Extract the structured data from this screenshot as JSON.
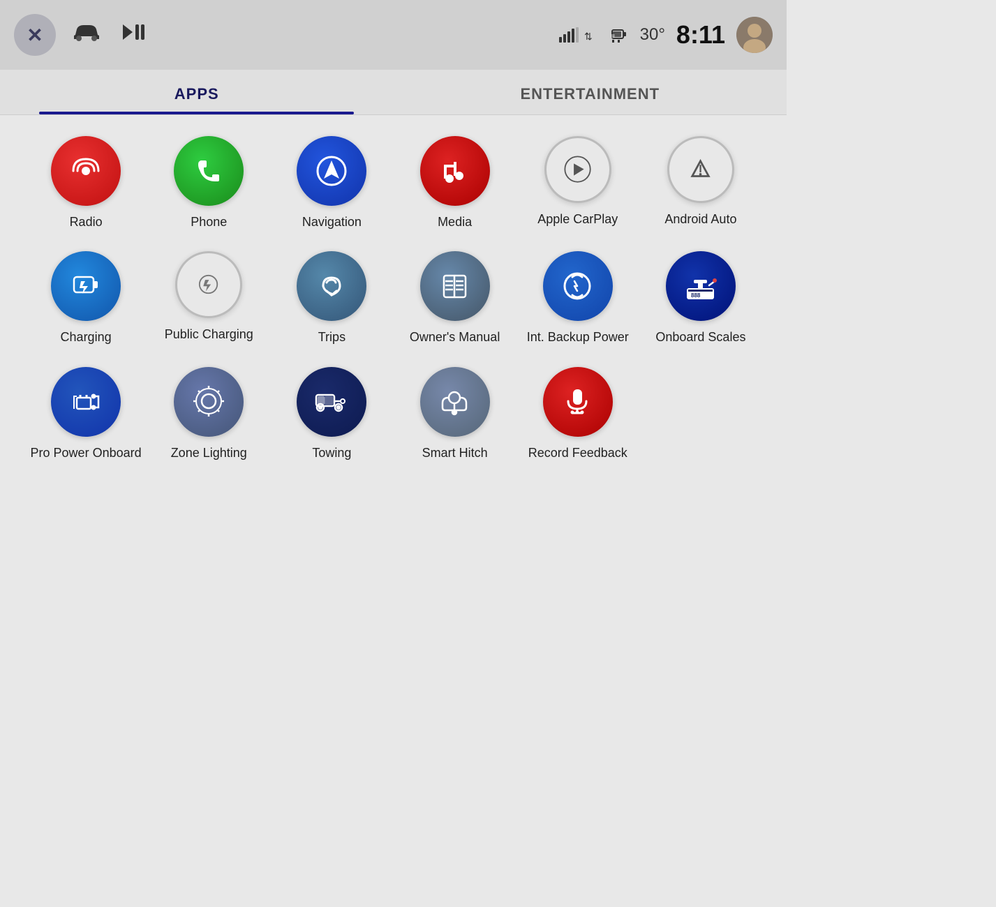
{
  "statusBar": {
    "temperature": "30°",
    "time": "8:11"
  },
  "tabs": [
    {
      "id": "apps",
      "label": "APPS",
      "active": true
    },
    {
      "id": "entertainment",
      "label": "ENTERTAINMENT",
      "active": false
    }
  ],
  "apps": [
    {
      "id": "radio",
      "label": "Radio",
      "iconType": "red",
      "row": 1
    },
    {
      "id": "phone",
      "label": "Phone",
      "iconType": "green",
      "row": 1
    },
    {
      "id": "navigation",
      "label": "Navigation",
      "iconType": "blue-nav",
      "row": 1
    },
    {
      "id": "media",
      "label": "Media",
      "iconType": "red-music",
      "row": 1
    },
    {
      "id": "apple-carplay",
      "label": "Apple CarPlay",
      "iconType": "light-gray",
      "row": 1
    },
    {
      "id": "android-auto",
      "label": "Android Auto",
      "iconType": "gray-auto",
      "row": 1
    },
    {
      "id": "charging",
      "label": "Charging",
      "iconType": "blue-charge",
      "row": 2
    },
    {
      "id": "public-charging",
      "label": "Public Charging",
      "iconType": "light-round",
      "row": 2
    },
    {
      "id": "trips",
      "label": "Trips",
      "iconType": "teal",
      "row": 2
    },
    {
      "id": "owners-manual",
      "label": "Owner's Manual",
      "iconType": "teal-book",
      "row": 2
    },
    {
      "id": "int-backup-power",
      "label": "Int. Backup Power",
      "iconType": "blue-power",
      "row": 2
    },
    {
      "id": "onboard-scales",
      "label": "Onboard Scales",
      "iconType": "dark-blue",
      "row": 2
    },
    {
      "id": "pro-power-onboard",
      "label": "Pro Power Onboard",
      "iconType": "blue-pro",
      "row": 3
    },
    {
      "id": "zone-lighting",
      "label": "Zone Lighting",
      "iconType": "gray-zone",
      "row": 3
    },
    {
      "id": "towing",
      "label": "Towing",
      "iconType": "dark-navy",
      "row": 3
    },
    {
      "id": "smart-hitch",
      "label": "Smart Hitch",
      "iconType": "gray-hitch",
      "row": 3
    },
    {
      "id": "record-feedback",
      "label": "Record Feedback",
      "iconType": "red-mic",
      "row": 3
    }
  ]
}
